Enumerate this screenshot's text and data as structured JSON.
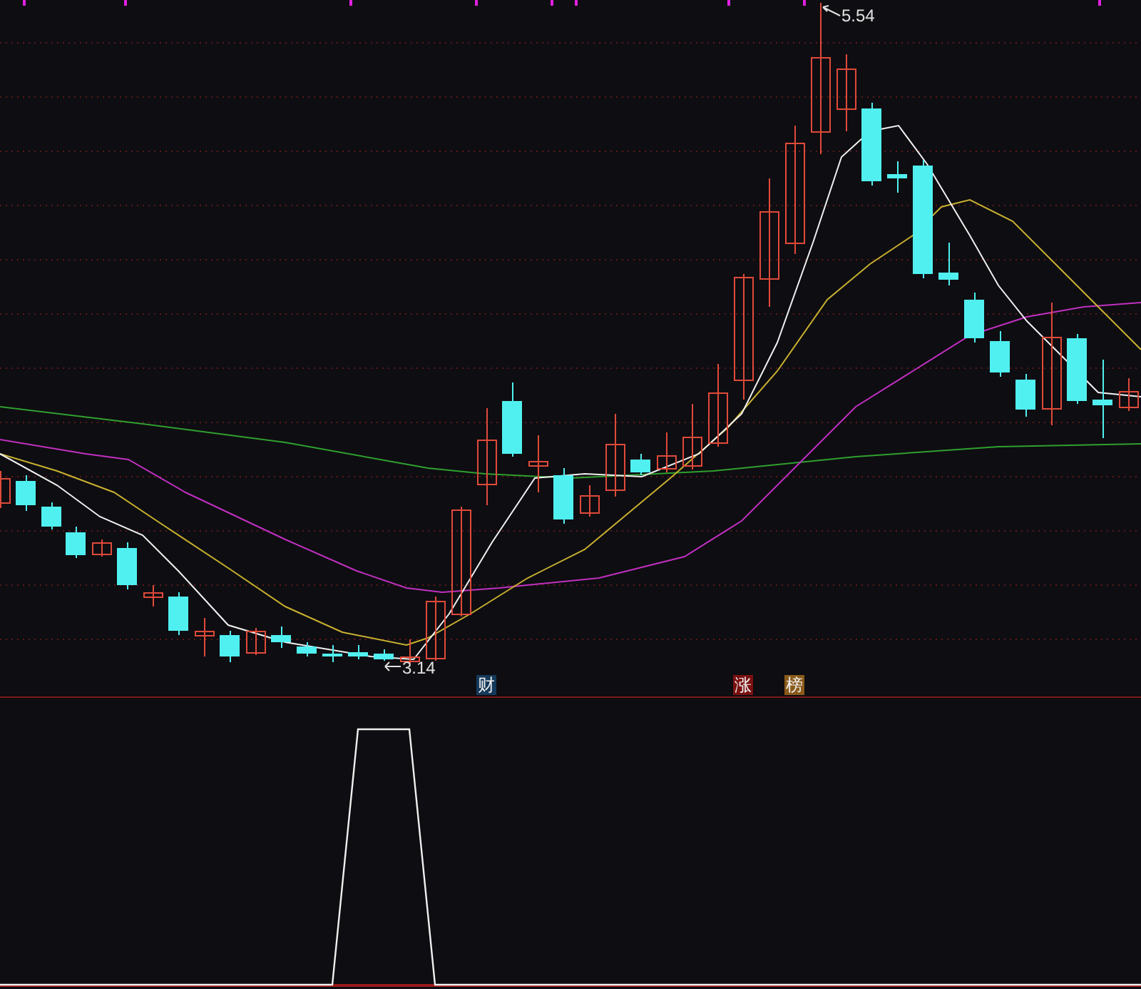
{
  "price_chart": {
    "high_label": "5.54",
    "low_label": "3.14"
  },
  "markers": [
    {
      "text": "财",
      "color": "#14395a"
    },
    {
      "text": "涨",
      "color": "#7a1010"
    },
    {
      "text": "榜",
      "color": "#8a5a1a"
    }
  ]
}
